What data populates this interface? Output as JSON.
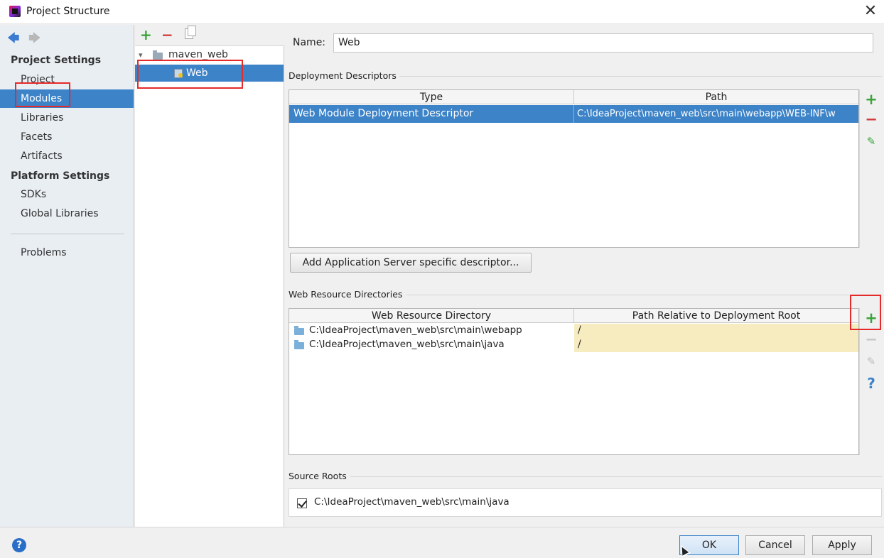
{
  "window": {
    "title": "Project Structure"
  },
  "nav": {
    "project_settings_header": "Project Settings",
    "platform_settings_header": "Platform Settings",
    "items": [
      {
        "label": "Project"
      },
      {
        "label": "Modules"
      },
      {
        "label": "Libraries"
      },
      {
        "label": "Facets"
      },
      {
        "label": "Artifacts"
      },
      {
        "label": "SDKs"
      },
      {
        "label": "Global Libraries"
      },
      {
        "label": "Problems"
      }
    ],
    "selected": "Modules"
  },
  "tree": {
    "root": "maven_web",
    "child": "Web"
  },
  "module": {
    "name_label": "Name:",
    "name_value": "Web"
  },
  "deployment": {
    "title": "Deployment Descriptors",
    "columns": [
      "Type",
      "Path"
    ],
    "rows": [
      {
        "type": "Web Module Deployment Descriptor",
        "path": "C:\\IdeaProject\\maven_web\\src\\main\\webapp\\WEB-INF\\w"
      }
    ],
    "add_button": "Add Application Server specific descriptor..."
  },
  "web_resources": {
    "title": "Web Resource Directories",
    "columns": [
      "Web Resource Directory",
      "Path Relative to Deployment Root"
    ],
    "rows": [
      {
        "directory": "C:\\IdeaProject\\maven_web\\src\\main\\webapp",
        "relative": "/"
      },
      {
        "directory": "C:\\IdeaProject\\maven_web\\src\\main\\java",
        "relative": "/"
      }
    ]
  },
  "source_roots": {
    "title": "Source Roots",
    "items": [
      {
        "path": "C:\\IdeaProject\\maven_web\\src\\main\\java",
        "checked": true
      }
    ]
  },
  "footer": {
    "ok": "OK",
    "cancel": "Cancel",
    "apply": "Apply",
    "help": "?"
  },
  "icons": {
    "add": "+",
    "remove": "−",
    "edit": "✎",
    "help": "?",
    "close": "✕",
    "back": "🡄",
    "forward": "🡆"
  },
  "colors": {
    "selection": "#3d83c8",
    "highlight_box": "#e52a2a",
    "add_green": "#3aa33a",
    "remove_red": "#d23a3a",
    "relative_path_cell": "#f7ecc0"
  }
}
